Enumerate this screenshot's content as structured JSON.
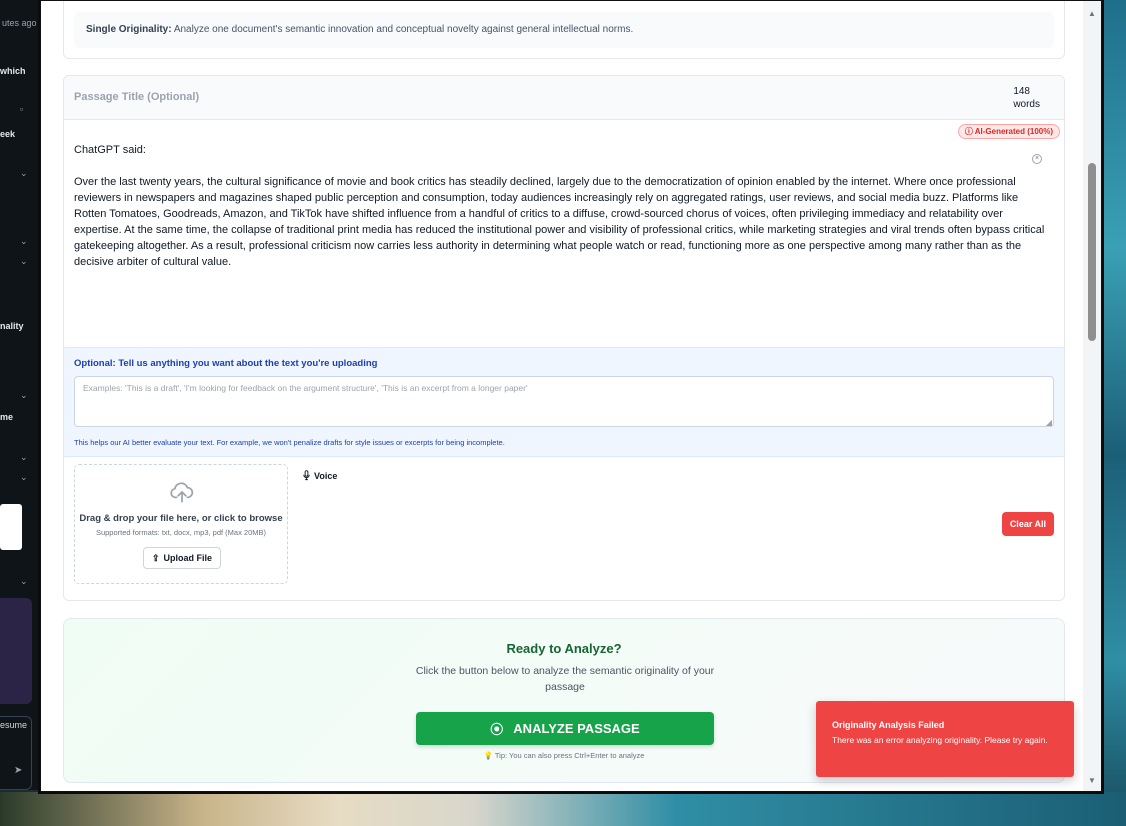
{
  "background": {
    "left_fragments": [
      "utes ago",
      "which",
      "eek",
      "nality",
      "me",
      "esume"
    ]
  },
  "top_card": {
    "label": "Single Originality:",
    "text": "Analyze one document's semantic innovation and conceptual novelty against general intellectual norms."
  },
  "editor": {
    "title_placeholder": "Passage Title (Optional)",
    "word_count": "148",
    "word_unit": "words",
    "ai_badge": "AI-Generated (100%)",
    "text_line1": "ChatGPT said:",
    "text_paragraph": "Over the last twenty years, the cultural significance of movie and book critics has steadily declined, largely due to the democratization of opinion enabled by the internet. Where once professional reviewers in newspapers and magazines shaped public perception and consumption, today audiences increasingly rely on aggregated ratings, user reviews, and social media buzz. Platforms like Rotten Tomatoes, Goodreads, Amazon, and TikTok have shifted influence from a handful of critics to a diffuse, crowd-sourced chorus of voices, often privileging immediacy and relatability over expertise. At the same time, the collapse of traditional print media has reduced the institutional power and visibility of professional critics, while marketing strategies and viral trends often bypass critical gatekeeping altogether. As a result, professional criticism now carries less authority in determining what people watch or read, functioning more as one perspective among many rather than as the decisive arbiter of cultural value."
  },
  "context": {
    "label": "Optional: Tell us anything you want about the text you're uploading",
    "placeholder": "Examples: 'This is a draft', 'I'm looking for feedback on the argument structure', 'This is an excerpt from a longer paper'",
    "help": "This helps our AI better evaluate your text. For example, we won't penalize drafts for style issues or excerpts for being incomplete."
  },
  "upload": {
    "title": "Drag & drop your file here, or click to browse",
    "formats": "Supported formats: txt, docx, mp3, pdf (Max 20MB)",
    "button": "Upload File"
  },
  "voice_label": "Voice",
  "clear_label": "Clear All",
  "analyze": {
    "title": "Ready to Analyze?",
    "desc": "Click the button below to analyze the semantic originality of your passage",
    "button": "ANALYZE PASSAGE",
    "tip": "Tip: You can also press Ctrl+Enter to analyze"
  },
  "toast": {
    "title": "Originality Analysis Failed",
    "body": "There was an error analyzing originality. Please try again."
  },
  "colors": {
    "accent_green": "#16a34a",
    "danger_red": "#ef4444",
    "info_blue": "#1e40af"
  }
}
